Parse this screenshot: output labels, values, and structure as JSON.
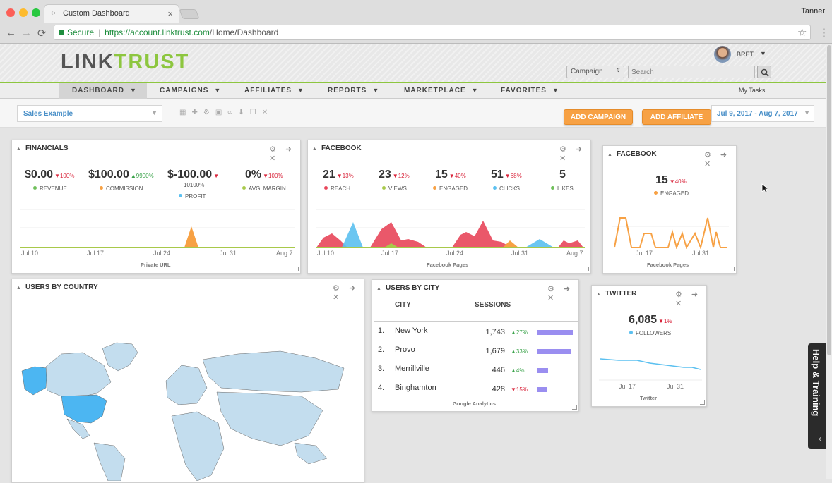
{
  "browser": {
    "tab_title": "Custom Dashboard",
    "tab_close": "×",
    "tab_icon": "‹›",
    "profile_name": "Tanner",
    "secure_label": "Secure",
    "url_host": "https://account.linktrust.com",
    "url_path": "/Home/Dashboard",
    "back": "←",
    "forward": "→",
    "reload": "⟳",
    "star": "☆",
    "menu": "⋮"
  },
  "header": {
    "logo_left": "LINK",
    "logo_right": "TRUST",
    "user_name": "BRET",
    "campaign_select": "Campaign",
    "search_placeholder": "Search"
  },
  "nav": {
    "items": [
      "DASHBOARD",
      "CAMPAIGNS",
      "AFFILIATES",
      "REPORTS",
      "MARKETPLACE",
      "FAVORITES"
    ],
    "my_tasks": "My Tasks",
    "caret": "▼"
  },
  "toolbar": {
    "dashboard_select": "Sales Example",
    "add_campaign": "ADD CAMPAIGN",
    "add_affiliate": "ADD AFFILIATE",
    "date_range": "Jul 9, 2017 - Aug 7, 2017"
  },
  "colors": {
    "accent_green": "#8dc63f",
    "orange": "#f7a144",
    "red": "#d9263c",
    "blue": "#5bc0f0",
    "olive": "#a8c94a"
  },
  "financials": {
    "title": "FINANCIALS",
    "metrics": [
      {
        "value": "$0.00",
        "change": "▼100%",
        "dir": "dn",
        "label": "REVENUE",
        "color": "#6fbf5a"
      },
      {
        "value": "$100.00",
        "change": "▲9900%",
        "dir": "up",
        "label": "COMMISSION",
        "color": "#f7a144"
      },
      {
        "value": "$-100.00",
        "change": "▼",
        "change2": "10100%",
        "dir": "dn",
        "label": "PROFIT",
        "color": "#5bc0f0"
      },
      {
        "value": "0%",
        "change": "▼100%",
        "dir": "dn",
        "label": "AVG. MARGIN",
        "color": "#a8c94a"
      }
    ],
    "axis": [
      "Jul 10",
      "Jul 17",
      "Jul 24",
      "Jul 31",
      "Aug 7"
    ],
    "caption": "Private URL"
  },
  "facebook1": {
    "title": "FACEBOOK",
    "metrics": [
      {
        "value": "21",
        "change": "▼13%",
        "label": "REACH",
        "color": "#e8465a"
      },
      {
        "value": "23",
        "change": "▼12%",
        "label": "VIEWS",
        "color": "#a8c94a"
      },
      {
        "value": "15",
        "change": "▼40%",
        "label": "ENGAGED",
        "color": "#f7a144"
      },
      {
        "value": "51",
        "change": "▼68%",
        "label": "CLICKS",
        "color": "#5bc0f0"
      },
      {
        "value": "5",
        "change": "",
        "label": "LIKES",
        "color": "#6fbf5a"
      }
    ],
    "axis": [
      "Jul 10",
      "Jul 17",
      "Jul 24",
      "Jul 31",
      "Aug 7"
    ],
    "caption": "Facebook Pages"
  },
  "facebook2": {
    "title": "FACEBOOK",
    "value": "15",
    "change": "▼40%",
    "label": "ENGAGED",
    "axis": [
      "Jul 17",
      "Jul 31"
    ],
    "caption": "Facebook Pages"
  },
  "users_by_country": {
    "title": "USERS BY COUNTRY"
  },
  "users_by_city": {
    "title": "USERS BY CITY",
    "col_city": "CITY",
    "col_sessions": "SESSIONS",
    "rows": [
      {
        "rank": "1.",
        "city": "New York",
        "sessions": "1,743",
        "change": "▲27%",
        "dir": "up",
        "bar": 1.0
      },
      {
        "rank": "2.",
        "city": "Provo",
        "sessions": "1,679",
        "change": "▲33%",
        "dir": "up",
        "bar": 0.96
      },
      {
        "rank": "3.",
        "city": "Merrillville",
        "sessions": "446",
        "change": "▲4%",
        "dir": "up",
        "bar": 0.3
      },
      {
        "rank": "4.",
        "city": "Binghamton",
        "sessions": "428",
        "change": "▼15%",
        "dir": "dn",
        "bar": 0.28
      }
    ],
    "caption": "Google Analytics"
  },
  "twitter": {
    "title": "TWITTER",
    "value": "6,085",
    "change": "▼1%",
    "label": "FOLLOWERS",
    "axis": [
      "Jul 17",
      "Jul 31"
    ],
    "caption": "Twitter"
  },
  "help": {
    "label": "Help & Training",
    "collapse": "‹"
  },
  "widget_controls": "⚙ ➜ ✕",
  "collapse_triangle": "▲"
}
